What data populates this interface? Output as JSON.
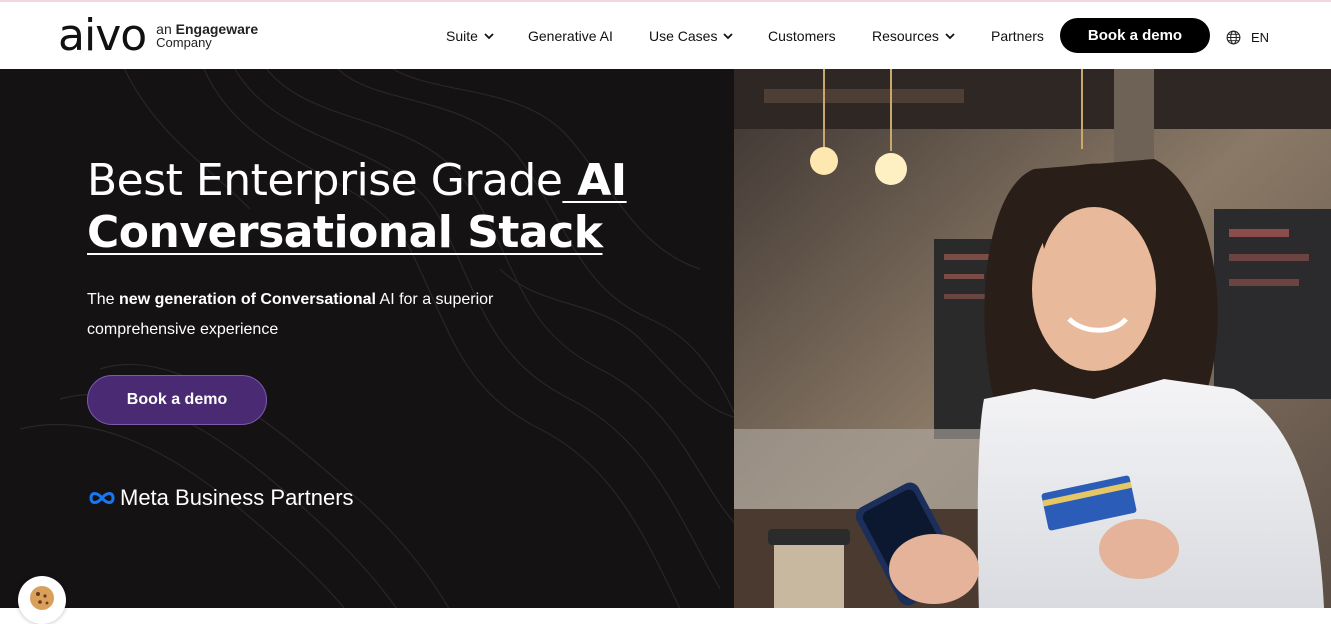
{
  "brand": {
    "logo_word": "aivo",
    "sub_prefix": "an",
    "sub_name": "Engageware",
    "sub_line2": "Company"
  },
  "nav": {
    "items": [
      {
        "label": "Suite",
        "has_dropdown": true
      },
      {
        "label": "Generative AI",
        "has_dropdown": false
      },
      {
        "label": "Use Cases",
        "has_dropdown": true
      },
      {
        "label": "Customers",
        "has_dropdown": false
      },
      {
        "label": "Resources",
        "has_dropdown": true
      },
      {
        "label": "Partners",
        "has_dropdown": false
      }
    ],
    "cta_label": "Book a demo",
    "lang_icon": "globe-icon",
    "lang_label": "EN"
  },
  "hero": {
    "title_part1": "Best Enterprise Grade",
    "title_part2_bold": " AI Conversational Stack",
    "subtitle_pre": "The ",
    "subtitle_bold": "new generation of Conversational",
    "subtitle_post": " AI for a superior comprehensive experience",
    "cta_label": "Book a demo",
    "partner_badge": "Meta Business Partners"
  },
  "colors": {
    "hero_bg": "#141213",
    "cta_purple": "#4a2a73",
    "meta_blue": "#1877f2"
  },
  "icons": {
    "cookie": "cookie-icon",
    "meta": "meta-infinity-icon",
    "chevron": "chevron-down-icon"
  }
}
